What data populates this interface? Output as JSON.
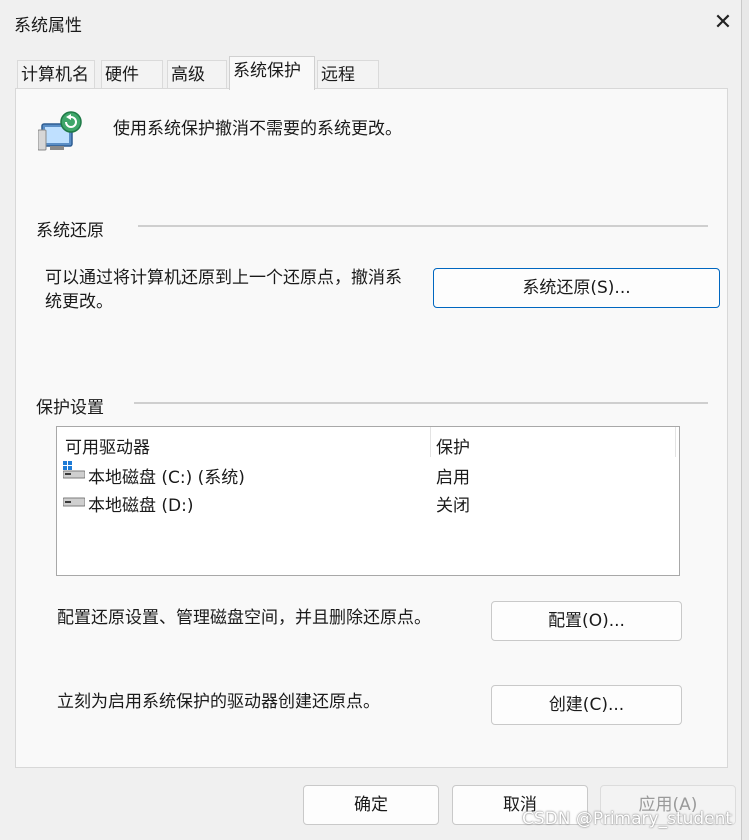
{
  "window": {
    "title": "系统属性",
    "close_glyph": "✕"
  },
  "tabs": [
    {
      "label": "计算机名"
    },
    {
      "label": "硬件"
    },
    {
      "label": "高级"
    },
    {
      "label": "系统保护",
      "active": true
    },
    {
      "label": "远程"
    }
  ],
  "intro": {
    "text": "使用系统保护撤消不需要的系统更改。",
    "icon": "computer-restore-icon"
  },
  "restore_group": {
    "title": "系统还原",
    "description_line1": "可以通过将计算机还原到上一个还原点，撤消系",
    "description_line2": "统更改。",
    "button_label": "系统还原(S)..."
  },
  "protection_group": {
    "title": "保护设置",
    "columns": [
      "可用驱动器",
      "保护"
    ],
    "drives": [
      {
        "name": "本地磁盘 (C:) (系统)",
        "protection": "启用",
        "icon": "system-drive-icon"
      },
      {
        "name": "本地磁盘 (D:)",
        "protection": "关闭",
        "icon": "drive-icon"
      }
    ],
    "configure_text": "配置还原设置、管理磁盘空间，并且删除还原点。",
    "configure_button": "配置(O)...",
    "create_text": "立刻为启用系统保护的驱动器创建还原点。",
    "create_button": "创建(C)..."
  },
  "footer": {
    "ok": "确定",
    "cancel": "取消",
    "apply": "应用(A)"
  },
  "watermark": "CSDN @Primary_student",
  "colors": {
    "accent": "#0067c0",
    "background": "#f3f3f3"
  }
}
